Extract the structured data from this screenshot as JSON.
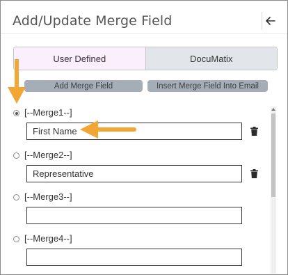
{
  "panel": {
    "title": "Add/Update Merge Field"
  },
  "icons": {
    "back": "arrow-left",
    "delete": "trash",
    "callout": "orange-arrow"
  },
  "tabs": [
    {
      "label": "User Defined",
      "active": true
    },
    {
      "label": "DocuMatix",
      "active": false
    }
  ],
  "actions": {
    "add_label": "Add Merge Field",
    "insert_label": "Insert Merge Field Into Email"
  },
  "fields": [
    {
      "label": "[--Merge1--]",
      "value": "First Name",
      "selected": true
    },
    {
      "label": "[--Merge2--]",
      "value": "Representative",
      "selected": false
    },
    {
      "label": "[--Merge3--]",
      "value": "",
      "selected": false
    },
    {
      "label": "[--Merge4--]",
      "value": "",
      "selected": false
    }
  ],
  "colors": {
    "active_tab_bg": "#fbeefd",
    "inactive_tab_bg": "#e2e5e9",
    "button_bg": "#a5adb6",
    "callout_arrow": "#f2a634"
  }
}
